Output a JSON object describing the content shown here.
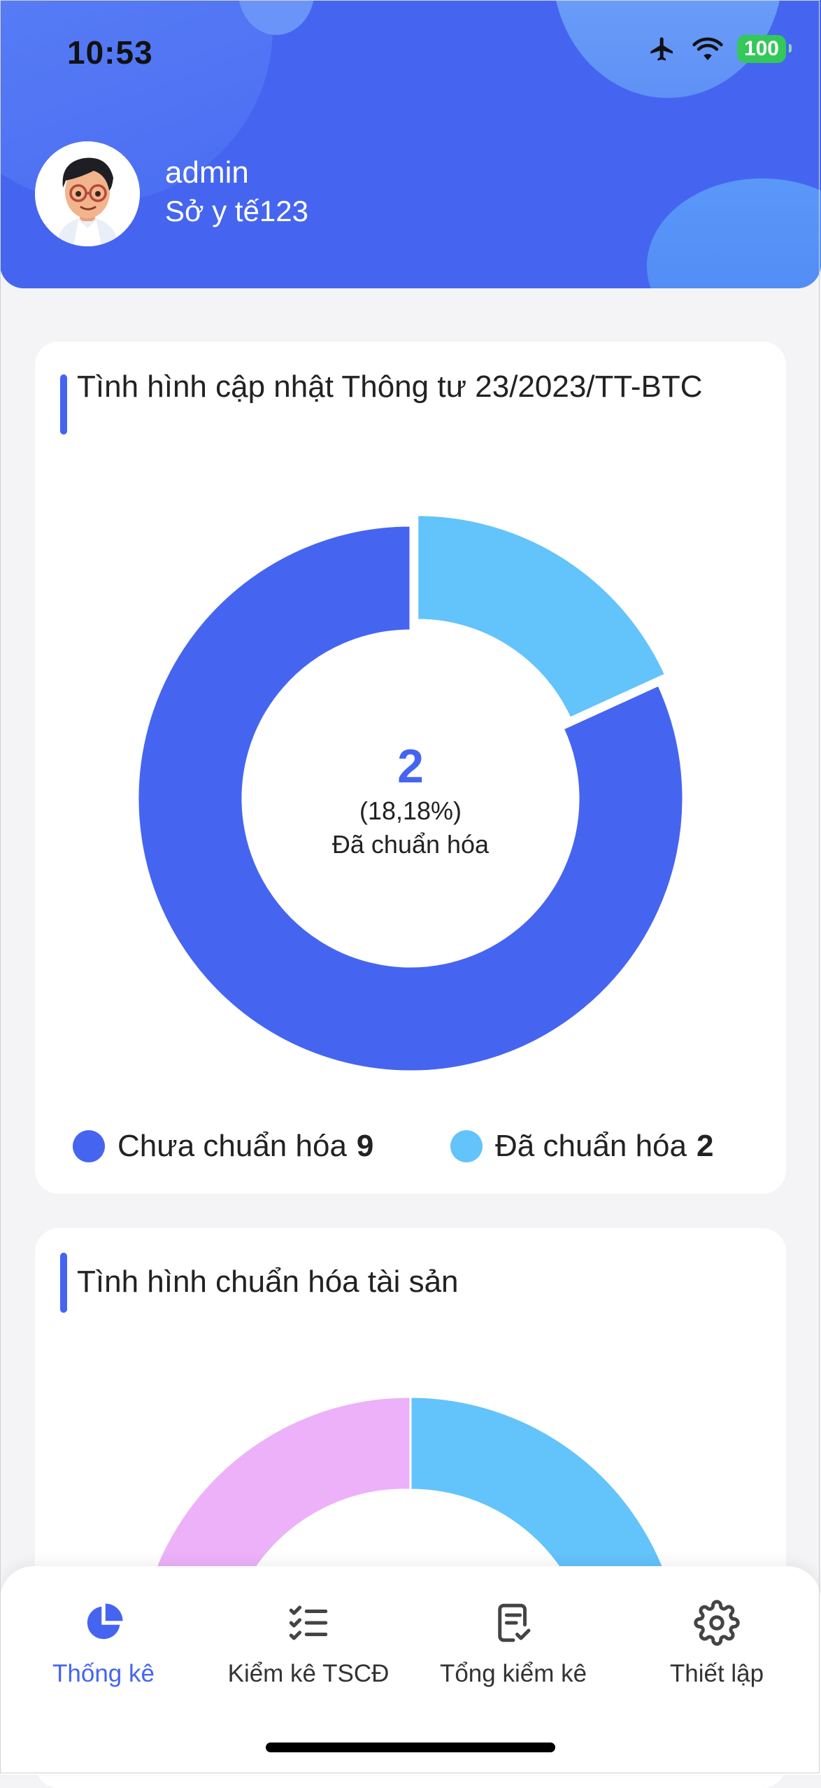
{
  "status_bar": {
    "time": "10:53",
    "battery": "100",
    "icons": [
      "airplane-icon",
      "wifi-icon",
      "battery-icon"
    ]
  },
  "profile": {
    "name": "admin",
    "org": "Sở y tế123"
  },
  "colors": {
    "primary": "#4565f0",
    "light_blue": "#63c3fb",
    "pink": "#ecb1f9",
    "battery_green": "#34c759"
  },
  "card1": {
    "title": "Tình hình cập nhật Thông tư 23/2023/TT-BTC",
    "center": {
      "value": "2",
      "percent": "(18,18%)",
      "label": "Đã chuẩn hóa"
    },
    "legend": [
      {
        "label": "Chưa chuẩn hóa",
        "count": "9",
        "color": "#4565f0"
      },
      {
        "label": "Đã chuẩn hóa",
        "count": "2",
        "color": "#63c3fb"
      }
    ]
  },
  "card2": {
    "title": "Tình hình chuẩn hóa tài sản"
  },
  "chart_data": [
    {
      "type": "pie",
      "categories": [
        "Chưa chuẩn hóa",
        "Đã chuẩn hóa"
      ],
      "values": [
        9,
        2
      ],
      "colors": [
        "#4565f0",
        "#63c3fb"
      ],
      "title": "Tình hình cập nhật Thông tư 23/2023/TT-BTC",
      "center_text": "2 (18,18%) Đã chuẩn hóa",
      "legend": "bottom"
    },
    {
      "type": "pie",
      "title": "Tình hình chuẩn hóa tài sản",
      "visible": "partial"
    }
  ],
  "bottom_nav": [
    {
      "label": "Thống kê",
      "icon": "pie-chart-icon",
      "active": true
    },
    {
      "label": "Kiểm kê TSCĐ",
      "icon": "checklist-icon",
      "active": false
    },
    {
      "label": "Tổng kiểm kê",
      "icon": "document-check-icon",
      "active": false
    },
    {
      "label": "Thiết lập",
      "icon": "gear-icon",
      "active": false
    }
  ]
}
